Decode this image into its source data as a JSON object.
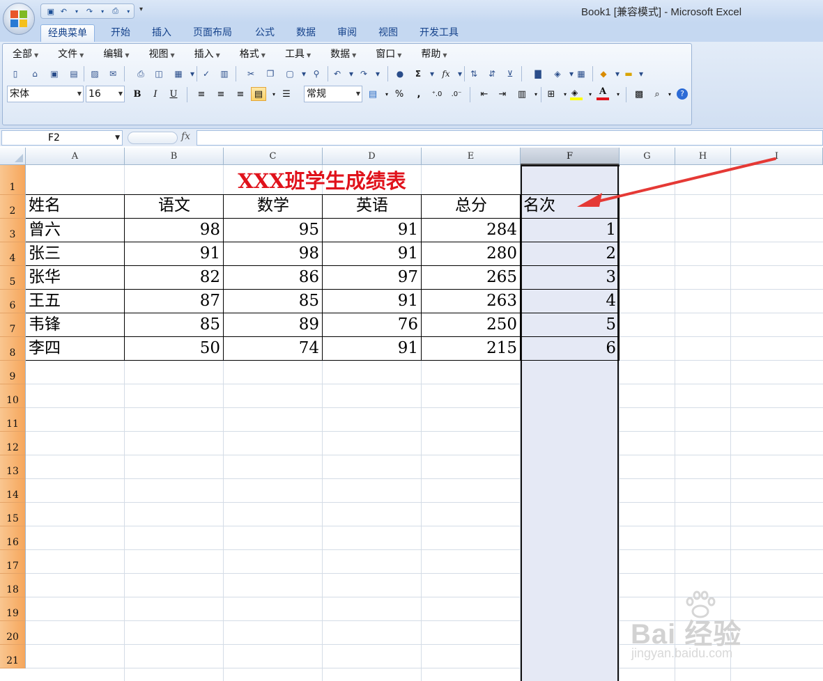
{
  "window": {
    "title": "Book1  [兼容模式] - Microsoft Excel"
  },
  "ribbon": {
    "tabs": [
      "经典菜单",
      "开始",
      "插入",
      "页面布局",
      "公式",
      "数据",
      "审阅",
      "视图",
      "开发工具"
    ],
    "active_tab": "经典菜单",
    "menus": [
      "全部",
      "文件",
      "编辑",
      "视图",
      "插入",
      "格式",
      "工具",
      "数据",
      "窗口",
      "帮助"
    ],
    "font_name": "宋体",
    "font_size": "16",
    "number_format": "常规",
    "bold_label": "B",
    "italic_label": "I",
    "underline_label": "U",
    "percent_label": "%",
    "comma_label": ",",
    "sum_label": "Σ",
    "fx_label": "fx",
    "font_color": "#e0121b",
    "fill_color": "#ffff00"
  },
  "formula_bar": {
    "name_box": "F2",
    "fx_label": "fx",
    "formula": ""
  },
  "sheet": {
    "columns": [
      "A",
      "B",
      "C",
      "D",
      "E",
      "F",
      "G",
      "H",
      "I"
    ],
    "selected_column": "F",
    "rows": [
      "1",
      "2",
      "3",
      "4",
      "5",
      "6",
      "7",
      "8",
      "9",
      "10",
      "11",
      "12",
      "13",
      "14",
      "15",
      "16",
      "17",
      "18",
      "19",
      "20",
      "21"
    ],
    "title": "XXX班学生成绩表",
    "title_color": "#e0121b",
    "headers": [
      "姓名",
      "语文",
      "数学",
      "英语",
      "总分",
      "名次"
    ],
    "records": [
      [
        "曾六",
        "98",
        "95",
        "91",
        "284",
        "1"
      ],
      [
        "张三",
        "91",
        "98",
        "91",
        "280",
        "2"
      ],
      [
        "张华",
        "82",
        "86",
        "97",
        "265",
        "3"
      ],
      [
        "王五",
        "87",
        "85",
        "91",
        "263",
        "4"
      ],
      [
        "韦锋",
        "85",
        "89",
        "76",
        "250",
        "5"
      ],
      [
        "李四",
        "50",
        "74",
        "91",
        "215",
        "6"
      ]
    ],
    "selected_column_fill": "#e5e9f5"
  },
  "annotation": {
    "color": "#e53935"
  },
  "watermark": {
    "main": "Bai 经验",
    "logo_text": "du",
    "sub": "jingyan.baidu.com"
  }
}
